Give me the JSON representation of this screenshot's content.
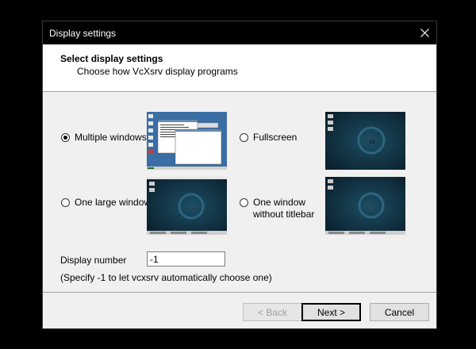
{
  "window": {
    "title": "Display settings"
  },
  "header": {
    "title": "Select display settings",
    "subtitle": "Choose how VcXsrv display programs"
  },
  "options": [
    {
      "label": "Multiple windows",
      "checked": true
    },
    {
      "label": "Fullscreen",
      "checked": false
    },
    {
      "label": "One large window",
      "checked": false
    },
    {
      "label": "One window\nwithout titlebar",
      "checked": false
    }
  ],
  "display_number": {
    "label": "Display number",
    "value": "-1",
    "hint": "(Specify -1 to let vcxsrv automatically choose one)"
  },
  "buttons": {
    "back": "< Back",
    "next": "Next >",
    "cancel": "Cancel"
  },
  "colors": {
    "desktop_blue": "#3a6ea5",
    "debian_dark": "#0c2a3a",
    "debian_teal": "#1d4e63"
  }
}
